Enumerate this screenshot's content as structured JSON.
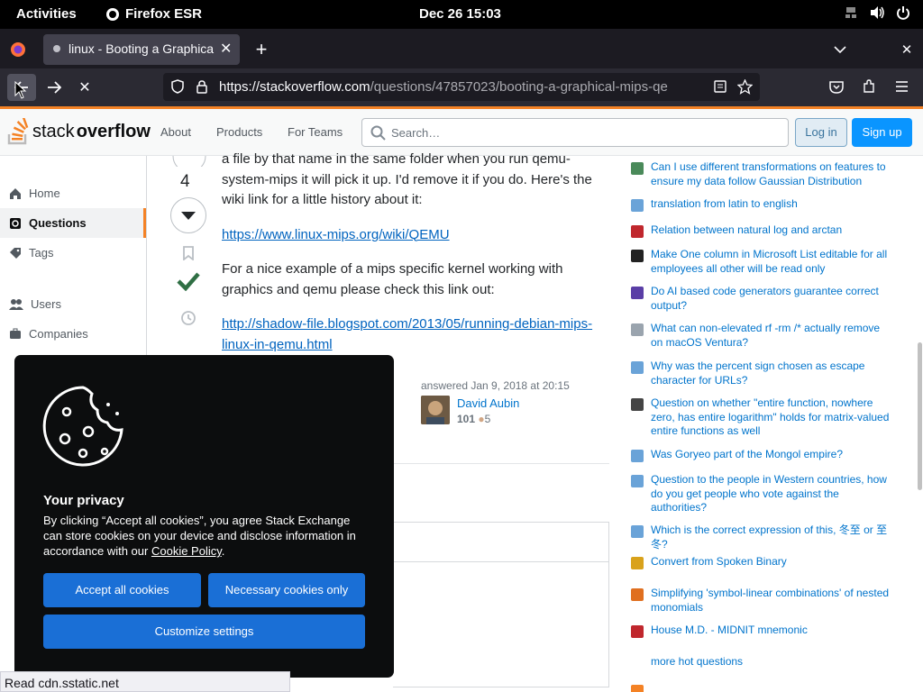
{
  "system_bar": {
    "activities": "Activities",
    "app_name": "Firefox ESR",
    "clock": "Dec 26  15:03"
  },
  "browser": {
    "tab_title": "linux - Booting a Graphica",
    "url_host": "https://stackoverflow.com",
    "url_path": "/questions/47857023/booting-a-graphical-mips-qe",
    "status_text": "Read cdn.sstatic.net"
  },
  "site_header": {
    "logo_plain": "stack",
    "logo_bold": "overflow",
    "nav_about": "About",
    "nav_products": "Products",
    "nav_teams": "For Teams",
    "search_placeholder": "Search…",
    "login": "Log in",
    "signup": "Sign up"
  },
  "left_nav": {
    "home": "Home",
    "questions": "Questions",
    "tags": "Tags",
    "users": "Users",
    "companies": "Companies"
  },
  "answer": {
    "vote_count": "4",
    "para1": "a file by that name in the same folder when you run qemu-system-mips it will pick it up. I'd remove it if you do. Here's the wiki link for a little history about it:",
    "link1": "https://www.linux-mips.org/wiki/QEMU",
    "para2": "For a nice example of a mips specific kernel working with graphics and qemu please check this link out:",
    "link2": "http://shadow-file.blogspot.com/2013/05/running-debian-mips-linux-in-qemu.html",
    "answered": "answered Jan 9, 2018 at 20:15",
    "user_name": "David Aubin",
    "user_rep": "101",
    "user_badges": "5"
  },
  "hot_questions": [
    {
      "title": "Can I use different transformations on features to ensure my data follow Gaussian Distribution",
      "color": "#4a8a5a"
    },
    {
      "title": "translation from latin to english",
      "color": "#6aa3d8"
    },
    {
      "title": "Relation between natural log and arctan",
      "color": "#c0272d"
    },
    {
      "title": "Make One column in Microsoft List editable for all employees all other will be read only",
      "color": "#222222"
    },
    {
      "title": "Do AI based code generators guarantee correct output?",
      "color": "#5a3ea6"
    },
    {
      "title": "What can non-elevated rf -rm /* actually remove on macOS Ventura?",
      "color": "#9aa4ae"
    },
    {
      "title": "Why was the percent sign chosen as escape character for URLs?",
      "color": "#6aa3d8"
    },
    {
      "title": "Question on whether \"entire function, nowhere zero, has entire logarithm\" holds for matrix-valued entire functions as well",
      "color": "#444444"
    },
    {
      "title": "Was Goryeo part of the Mongol empire?",
      "color": "#6aa3d8"
    },
    {
      "title": "Question to the people in Western countries, how do you get people who vote against the authorities?",
      "color": "#6aa3d8"
    },
    {
      "title": "Which is the correct expression of this, 冬至 or 至冬?",
      "color": "#6aa3d8"
    },
    {
      "title": "Convert from Spoken Binary",
      "color": "#d9a21b"
    },
    {
      "title": "Simplifying 'symbol-linear combinations' of nested monomials",
      "color": "#e06f1f"
    },
    {
      "title": "House M.D. - MIDNIT mnemonic",
      "color": "#c0272d"
    }
  ],
  "more_hot": "more hot questions",
  "cookie_dialog": {
    "heading": "Your privacy",
    "body": "By clicking “Accept all cookies”, you agree Stack Exchange can store cookies on your device and disclose information in accordance with our",
    "policy_link": "Cookie Policy",
    "accept_all": "Accept all cookies",
    "necessary": "Necessary cookies only",
    "customize": "Customize settings"
  },
  "colors": {
    "accent_orange": "#f48225",
    "link_blue": "#0063bf",
    "button_blue": "#0a95ff",
    "accepted_green": "#2f6f44"
  }
}
